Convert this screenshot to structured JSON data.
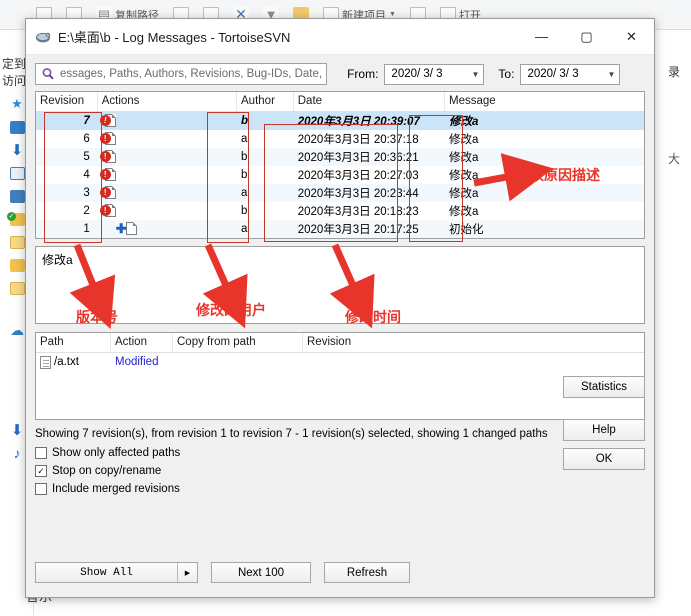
{
  "background": {
    "ribbon_items": [
      {
        "icon": "copy-icon",
        "label": ""
      },
      {
        "icon": "paste-icon",
        "label": ""
      },
      {
        "icon": "copy-path-icon",
        "label": "复制路径"
      },
      {
        "icon": "move-to-icon",
        "label": ""
      },
      {
        "icon": "copy-to-icon",
        "label": ""
      },
      {
        "icon": "delete-icon",
        "label": ""
      },
      {
        "icon": "filter-icon",
        "label": ""
      },
      {
        "icon": "folder-icon",
        "label": ""
      },
      {
        "icon": "new-item-icon",
        "label": "新建项目"
      },
      {
        "icon": "new-folder-icon",
        "label": ""
      },
      {
        "icon": "properties-icon",
        "label": "打开"
      }
    ],
    "nav_labels": [
      "定到",
      "访问"
    ],
    "music_label": "音乐",
    "right_edge_labels": [
      "录",
      "大"
    ],
    "nav_icons": [
      "favorites-star-icon",
      "desktop-icon",
      "downloads-icon",
      "documents-icon",
      "pictures-icon",
      "verified-folder-icon",
      "folder-icon",
      "folder-icon",
      "folder-icon",
      "onedrive-icon"
    ]
  },
  "dialog": {
    "title": "E:\\桌面\\b - Log Messages - TortoiseSVN",
    "icon": "tortoisesvn-icon",
    "window_buttons": {
      "minimize": "—",
      "maximize": "▢",
      "close": "✕"
    },
    "filter": {
      "search_placeholder": "essages, Paths, Authors, Revisions, Bug-IDs, Date,",
      "search_icon": "search-icon",
      "from_label": "From:",
      "from_value": "2020/ 3/ 3",
      "to_label": "To:",
      "to_value": "2020/ 3/ 3"
    },
    "log_table": {
      "columns": [
        "Revision",
        "Actions",
        "Author",
        "Date",
        "Message"
      ],
      "rows": [
        {
          "revision": "7",
          "action": "modified",
          "author": "b",
          "date": "2020年3月3日 20:39:07",
          "message": "修改a",
          "selected": true
        },
        {
          "revision": "6",
          "action": "modified",
          "author": "a",
          "date": "2020年3月3日 20:37:18",
          "message": "修改a",
          "selected": false
        },
        {
          "revision": "5",
          "action": "modified",
          "author": "b",
          "date": "2020年3月3日 20:36:21",
          "message": "修改a",
          "selected": false
        },
        {
          "revision": "4",
          "action": "modified",
          "author": "b",
          "date": "2020年3月3日 20:27:03",
          "message": "修改a",
          "selected": false
        },
        {
          "revision": "3",
          "action": "modified",
          "author": "a",
          "date": "2020年3月3日 20:23:44",
          "message": "修改a",
          "selected": false
        },
        {
          "revision": "2",
          "action": "modified",
          "author": "b",
          "date": "2020年3月3日 20:18:23",
          "message": "修改a",
          "selected": false
        },
        {
          "revision": "1",
          "action": "added",
          "author": "a",
          "date": "2020年3月3日 20:17:25",
          "message": "初始化",
          "selected": false
        }
      ]
    },
    "message_detail": "修改a",
    "path_table": {
      "columns": [
        "Path",
        "Action",
        "Copy from path",
        "Revision"
      ],
      "rows": [
        {
          "path": "/a.txt",
          "action": "Modified",
          "copy_from_path": "",
          "revision": "",
          "icon": "file-icon"
        }
      ]
    },
    "status_text": "Showing 7 revision(s), from revision 1 to revision 7 - 1 revision(s) selected, showing 1 changed paths",
    "checkboxes": [
      {
        "label": "Show only affected paths",
        "checked": false
      },
      {
        "label": "Stop on copy/rename",
        "checked": true
      },
      {
        "label": "Include merged revisions",
        "checked": false
      }
    ],
    "buttons": {
      "show_all": "Show All",
      "show_all_arrow": "▶",
      "next_100": "Next 100",
      "refresh": "Refresh",
      "statistics": "Statistics",
      "help": "Help",
      "ok": "OK"
    }
  },
  "annotations": [
    {
      "id": "reason",
      "text": "修改原因描述"
    },
    {
      "id": "version",
      "text": "版本号"
    },
    {
      "id": "user",
      "text": "修改的用户"
    },
    {
      "id": "time",
      "text": "修改时间"
    }
  ],
  "colors": {
    "annotation": "#e8352b",
    "selection": "#cce4f7",
    "action_link": "#2222cc"
  }
}
